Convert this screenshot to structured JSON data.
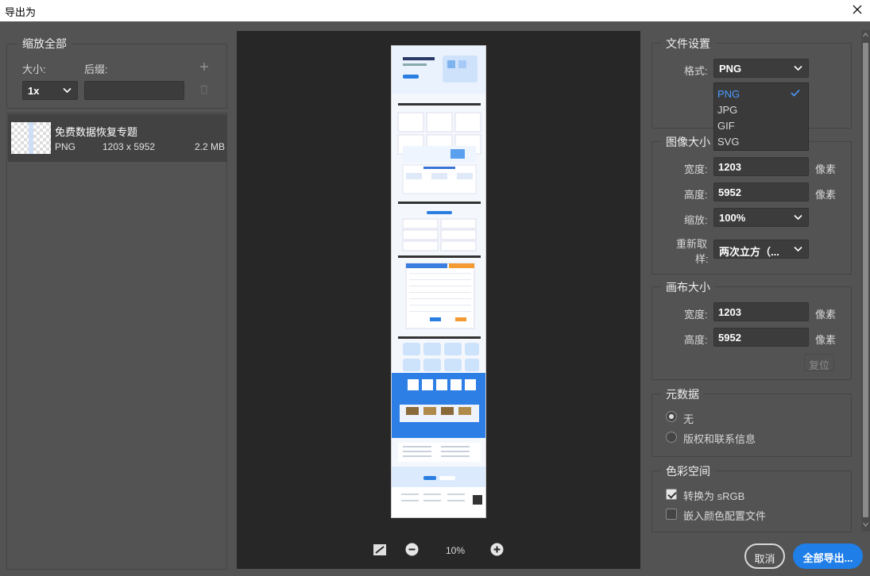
{
  "window": {
    "title": "导出为"
  },
  "left": {
    "legend": "缩放全部",
    "size_label": "大小:",
    "suffix_label": "后缀:",
    "size_value": "1x",
    "suffix_value": "",
    "item": {
      "name": "免费数据恢复专题",
      "format": "PNG",
      "dimensions": "1203 x 5952",
      "filesize": "2.2 MB"
    }
  },
  "preview": {
    "zoom": "10%"
  },
  "file_settings": {
    "legend": "文件设置",
    "format_label": "格式:",
    "format_value": "PNG",
    "options": [
      "PNG",
      "JPG",
      "GIF",
      "SVG"
    ],
    "selected_option": "PNG"
  },
  "image_size": {
    "legend": "图像大小",
    "width_label": "宽度:",
    "width_value": "1203",
    "height_label": "高度:",
    "height_value": "5952",
    "unit": "像素",
    "scale_label": "缩放:",
    "scale_value": "100%",
    "resample_label_1": "重新取",
    "resample_label_2": "样:",
    "resample_value": "两次立方（..."
  },
  "canvas_size": {
    "legend": "画布大小",
    "width_label": "宽度:",
    "width_value": "1203",
    "height_label": "高度:",
    "height_value": "5952",
    "unit": "像素",
    "reset_label": "复位"
  },
  "metadata": {
    "legend": "元数据",
    "option_none": "无",
    "option_copyright": "版权和联系信息"
  },
  "color_space": {
    "legend": "色彩空间",
    "convert_label": "转换为 sRGB",
    "embed_label": "嵌入颜色配置文件"
  },
  "buttons": {
    "cancel": "取消",
    "export_all": "全部导出..."
  },
  "colors": {
    "accent": "#1f7ee8",
    "panel": "#535353",
    "preview_bg": "#272727"
  }
}
